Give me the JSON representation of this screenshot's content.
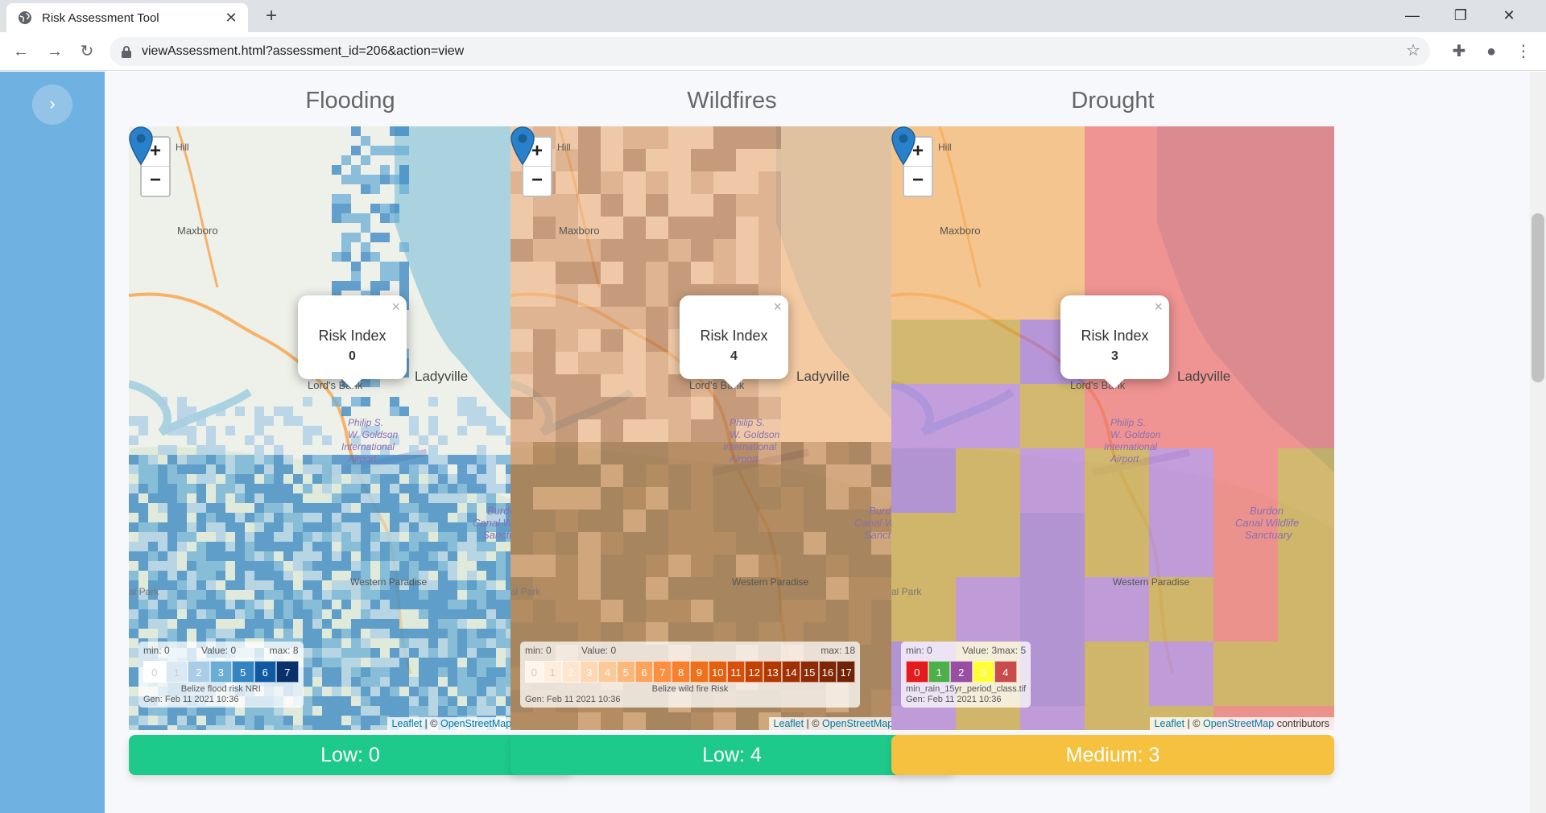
{
  "browser": {
    "tab_title": "Risk Assessment Tool",
    "new_tab_label": "+",
    "url": "viewAssessment.html?assessment_id=206&action=view"
  },
  "zoom": {
    "in": "+",
    "out": "−"
  },
  "hazards": [
    {
      "title": "Flooding",
      "popup": {
        "label": "Risk Index",
        "value": "0"
      },
      "legend": {
        "min": "min: 0",
        "value": "Value: 0",
        "max": "max: 8",
        "swatches": [
          "0",
          "1",
          "2",
          "3",
          "5",
          "6",
          "7"
        ],
        "colors": [
          "#ffffff",
          "#dbe9f6",
          "#a9cde6",
          "#6aaed6",
          "#3484c1",
          "#0e59a2",
          "#08306b"
        ],
        "name": "Belize flood risk NRI",
        "generated": "Gen: Feb 11 2021 10:36"
      },
      "risk": {
        "text": "Low: 0",
        "color": "#1ec98c"
      }
    },
    {
      "title": "Wildfires",
      "popup": {
        "label": "Risk Index",
        "value": "4"
      },
      "legend": {
        "min": "min: 0",
        "value": "Value: 0",
        "max": "max: 18",
        "swatches": [
          "0",
          "1",
          "2",
          "3",
          "4",
          "5",
          "6",
          "7",
          "8",
          "9",
          "10",
          "11",
          "12",
          "13",
          "14",
          "15",
          "16",
          "17"
        ],
        "colors": [
          "#fff5eb",
          "#feeddc",
          "#fee6ce",
          "#fdd8b3",
          "#fdc997",
          "#fdb77a",
          "#fda35c",
          "#fd8f43",
          "#f87f2c",
          "#f0701a",
          "#e3600f",
          "#d65009",
          "#c44103",
          "#b23802",
          "#a03003",
          "#8e2a04",
          "#7f2704",
          "#6f2204"
        ],
        "name": "Belize wild fire Risk",
        "generated": "Gen: Feb 11 2021 10:36"
      },
      "risk": {
        "text": "Low: 4",
        "color": "#1ec98c"
      }
    },
    {
      "title": "Drought",
      "popup": {
        "label": "Risk Index",
        "value": "3"
      },
      "legend": {
        "min": "min: 0",
        "value": "Value: 3",
        "max": "max: 5",
        "swatches": [
          "0",
          "1",
          "2",
          "3",
          "4"
        ],
        "colors": [
          "#e41a1c",
          "#4daf4a",
          "#984ea3",
          "#ffff33",
          "#c94c4c"
        ],
        "name": "min_rain_15yr_period_class.tif",
        "generated": "Gen: Feb 11 2021 10:36"
      },
      "risk": {
        "text": "Medium: 3",
        "color": "#f5c13f"
      }
    }
  ],
  "map_labels": {
    "hill": "Hill",
    "maxboro": "Maxboro",
    "ladyville": "Ladyville",
    "lords_bank": "Lord's Bank",
    "airport": [
      "Philip S.",
      "W. Goldson",
      "International",
      "Airport"
    ],
    "burdon": [
      "Burdon",
      "Canal Wildlife",
      "Sanctuary"
    ],
    "western_paradise": "Western Paradise",
    "park": "al Park"
  },
  "attribution": {
    "leaflet": "Leaflet",
    "sep": " | © ",
    "osm": "OpenStreetMap",
    "contrib": " contributors"
  },
  "scroll_top_label": "▲"
}
